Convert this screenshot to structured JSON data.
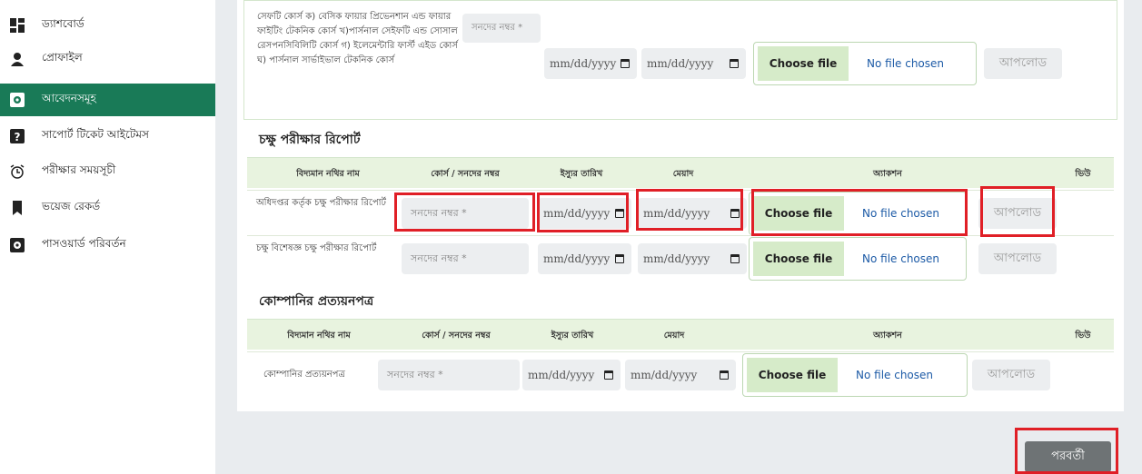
{
  "sidebar": {
    "items": [
      {
        "label": "ড্যাশবোর্ড",
        "icon": "dashboard-icon"
      },
      {
        "label": "প্রোফাইল",
        "icon": "user-icon"
      },
      {
        "label": "আবেদনসমূহ",
        "icon": "application-icon"
      },
      {
        "label": "সাপোর্ট টিকেট আইটেমস",
        "icon": "question-icon"
      },
      {
        "label": "পরীক্ষার সময়সূচী",
        "icon": "alarm-clock-icon"
      },
      {
        "label": "ভয়েজ রেকর্ড",
        "icon": "bookmark-icon"
      },
      {
        "label": "পাসওয়ার্ড পরিবর্তন",
        "icon": "key-icon"
      }
    ]
  },
  "top_row": {
    "doc_name": "সেফটি কোর্স ক) বেসিক ফায়ার প্রিভেনশান এন্ড ফায়ার ফাইটিং টেকনিক কোর্স খ)পার্সনাল সেইফটি এন্ড সোসাল রেসপনসিবিলিটি কোর্স গ) ইলেমেন্টারি ফার্স্ট এইড কোর্স ঘ) পার্সনাল সার্ভাইভাল টেকনিক কোর্স",
    "cert_placeholder": "সনদের নম্বর *",
    "issue_date": "mm/dd/yyyy",
    "expiry_date": "mm/dd/yyyy",
    "choose_file": "Choose file",
    "no_file": "No file chosen",
    "upload": "আপলোড"
  },
  "eye_section": {
    "title": "চক্ষু পরীক্ষার রিপোর্ট",
    "headers": [
      "বিদ্যমান নথির নাম",
      "কোর্স / সনদের নম্বর",
      "ইস্যুর তারিখ",
      "মেয়াদ",
      "অ্যাকশন",
      "ভিউ"
    ],
    "rows": [
      {
        "doc_name": "অধিদপ্তর কর্তৃক চক্ষু পরীক্ষার রিপোর্ট",
        "cert_placeholder": "সনদের নম্বর *",
        "issue_date": "mm/dd/yyyy",
        "expiry_date": "mm/dd/yyyy",
        "choose_file": "Choose file",
        "no_file": "No file chosen",
        "upload": "আপলোড"
      },
      {
        "doc_name": "চক্ষু বিশেষজ্ঞ চক্ষু পরীক্ষার রিপোর্ট",
        "cert_placeholder": "সনদের নম্বর *",
        "issue_date": "mm/dd/yyyy",
        "expiry_date": "mm/dd/yyyy",
        "choose_file": "Choose file",
        "no_file": "No file chosen",
        "upload": "আপলোড"
      }
    ]
  },
  "company_section": {
    "title": "কোম্পানির প্রত্যয়নপত্র",
    "headers": [
      "বিদ্যমান নথির নাম",
      "কোর্স / সনদের নম্বর",
      "ইস্যুর তারিখ",
      "মেয়াদ",
      "অ্যাকশন",
      "ভিউ"
    ],
    "rows": [
      {
        "doc_name": "কোম্পানির প্রত্যয়নপত্র",
        "cert_placeholder": "সনদের নম্বর *",
        "issue_date": "mm/dd/yyyy",
        "expiry_date": "mm/dd/yyyy",
        "choose_file": "Choose file",
        "no_file": "No file chosen",
        "upload": "আপলোড"
      }
    ]
  },
  "footer": {
    "next_label": "পরবর্তী"
  },
  "colors": {
    "accent": "#197a57",
    "header_bg": "#e8f3df",
    "highlight": "#e01f26"
  }
}
